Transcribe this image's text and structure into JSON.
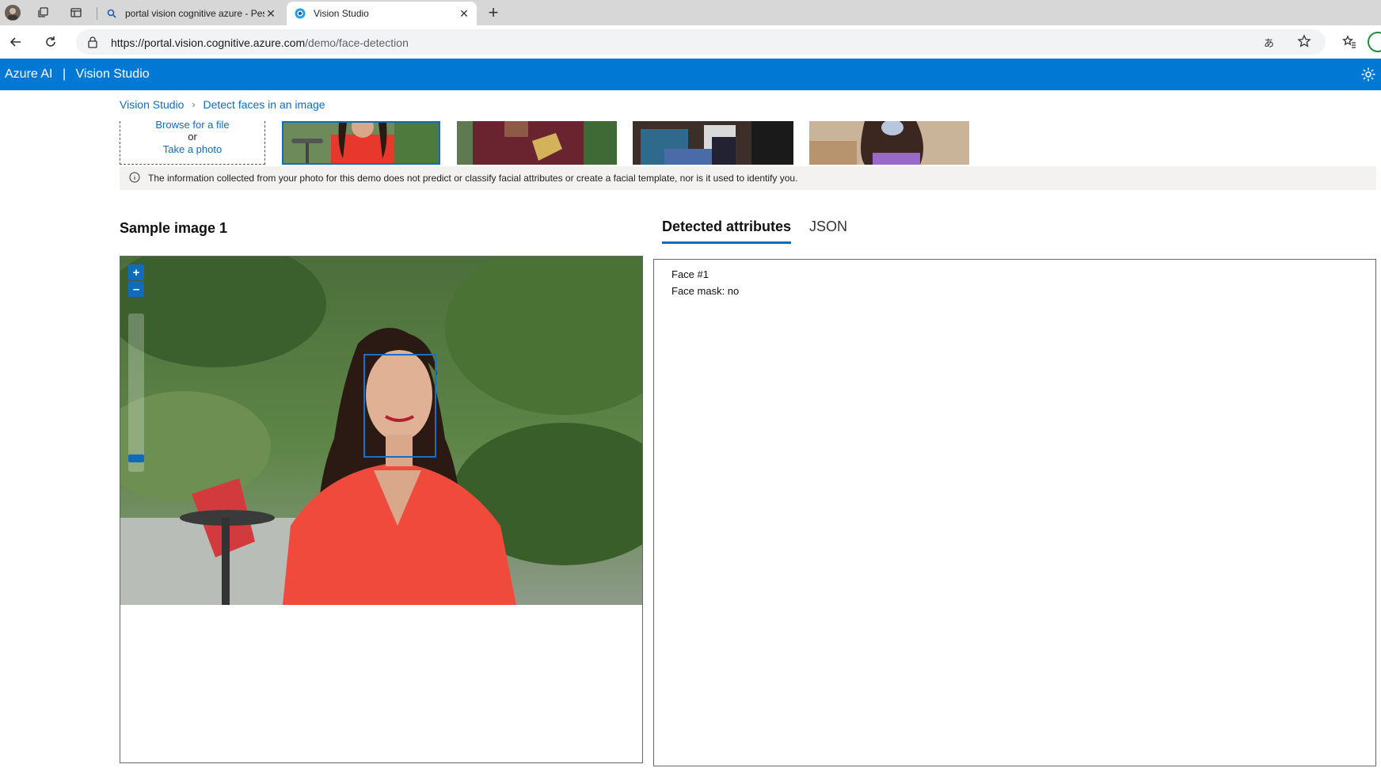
{
  "browser": {
    "tabs": [
      {
        "title": "portal vision cognitive azure - Pes",
        "active": false,
        "icon": "search-icon"
      },
      {
        "title": "Vision Studio",
        "active": true,
        "icon": "vision-studio-icon"
      }
    ],
    "address": {
      "host": "https://portal.vision.cognitive.azure.com",
      "path": "/demo/face-detection"
    }
  },
  "header": {
    "brand_prefix": "Azure AI",
    "brand_separator": "|",
    "brand_name": "Vision Studio",
    "accent": "#0078d4"
  },
  "breadcrumb": {
    "root": "Vision Studio",
    "current": "Detect faces in an image"
  },
  "upload": {
    "browse": "Browse for a file",
    "or": "or",
    "take_photo": "Take a photo"
  },
  "info": {
    "text": "The information collected from your photo for this demo does not predict or classify facial attributes or create a facial template, nor is it used to identify you."
  },
  "sample": {
    "title": "Sample image 1",
    "zoom_in": "+",
    "zoom_out": "–"
  },
  "result_tabs": {
    "attributes": "Detected attributes",
    "json": "JSON"
  },
  "results": {
    "face_label": "Face #1",
    "mask_line": "Face mask: no"
  }
}
